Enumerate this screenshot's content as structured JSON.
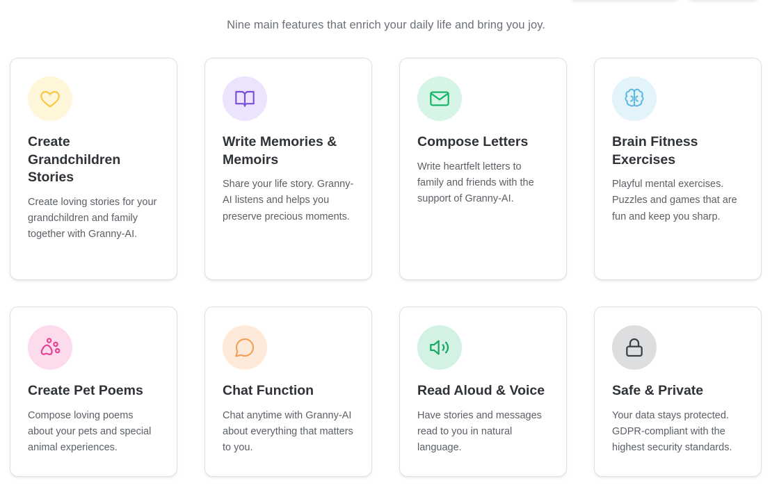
{
  "header": {
    "subtitle": "Nine main features that enrich your daily life and bring you joy."
  },
  "features": [
    {
      "title": "Create Grandchildren Stories",
      "description": "Create loving stories for your grandchildren and family together with Granny-AI.",
      "icon": "heart-icon",
      "icon_color": "#f5c842",
      "icon_bg": "#fff6d9"
    },
    {
      "title": "Write Memories & Memoirs",
      "description": "Share your life story. Granny-AI listens and helps you preserve precious moments.",
      "icon": "book-icon",
      "icon_color": "#7c4ddb",
      "icon_bg": "#ece3fc"
    },
    {
      "title": "Compose Letters",
      "description": "Write heartfelt letters to family and friends with the support of Granny-AI.",
      "icon": "mail-icon",
      "icon_color": "#19b56b",
      "icon_bg": "#d6f5e6"
    },
    {
      "title": "Brain Fitness Exercises",
      "description": "Playful mental exercises. Puzzles and games that are fun and keep you sharp.",
      "icon": "brain-icon",
      "icon_color": "#5db8e0",
      "icon_bg": "#e2f3fa"
    },
    {
      "title": "Create Pet Poems",
      "description": "Compose loving poems about your pets and special animal experiences.",
      "icon": "paw-icon",
      "icon_color": "#e93d92",
      "icon_bg": "#fcdcec"
    },
    {
      "title": "Chat Function",
      "description": "Chat anytime with Granny-AI about everything that matters to you.",
      "icon": "chat-bubble-icon",
      "icon_color": "#f0a05a",
      "icon_bg": "#feeadb"
    },
    {
      "title": "Read Aloud & Voice",
      "description": "Have stories and messages read to you in natural language.",
      "icon": "speaker-icon",
      "icon_color": "#19a864",
      "icon_bg": "#d3f2e3"
    },
    {
      "title": "Safe & Private",
      "description": "Your data stays protected. GDPR-compliant with the highest security standards.",
      "icon": "lock-icon",
      "icon_color": "#3a3f45",
      "icon_bg": "#dcdedf"
    }
  ]
}
